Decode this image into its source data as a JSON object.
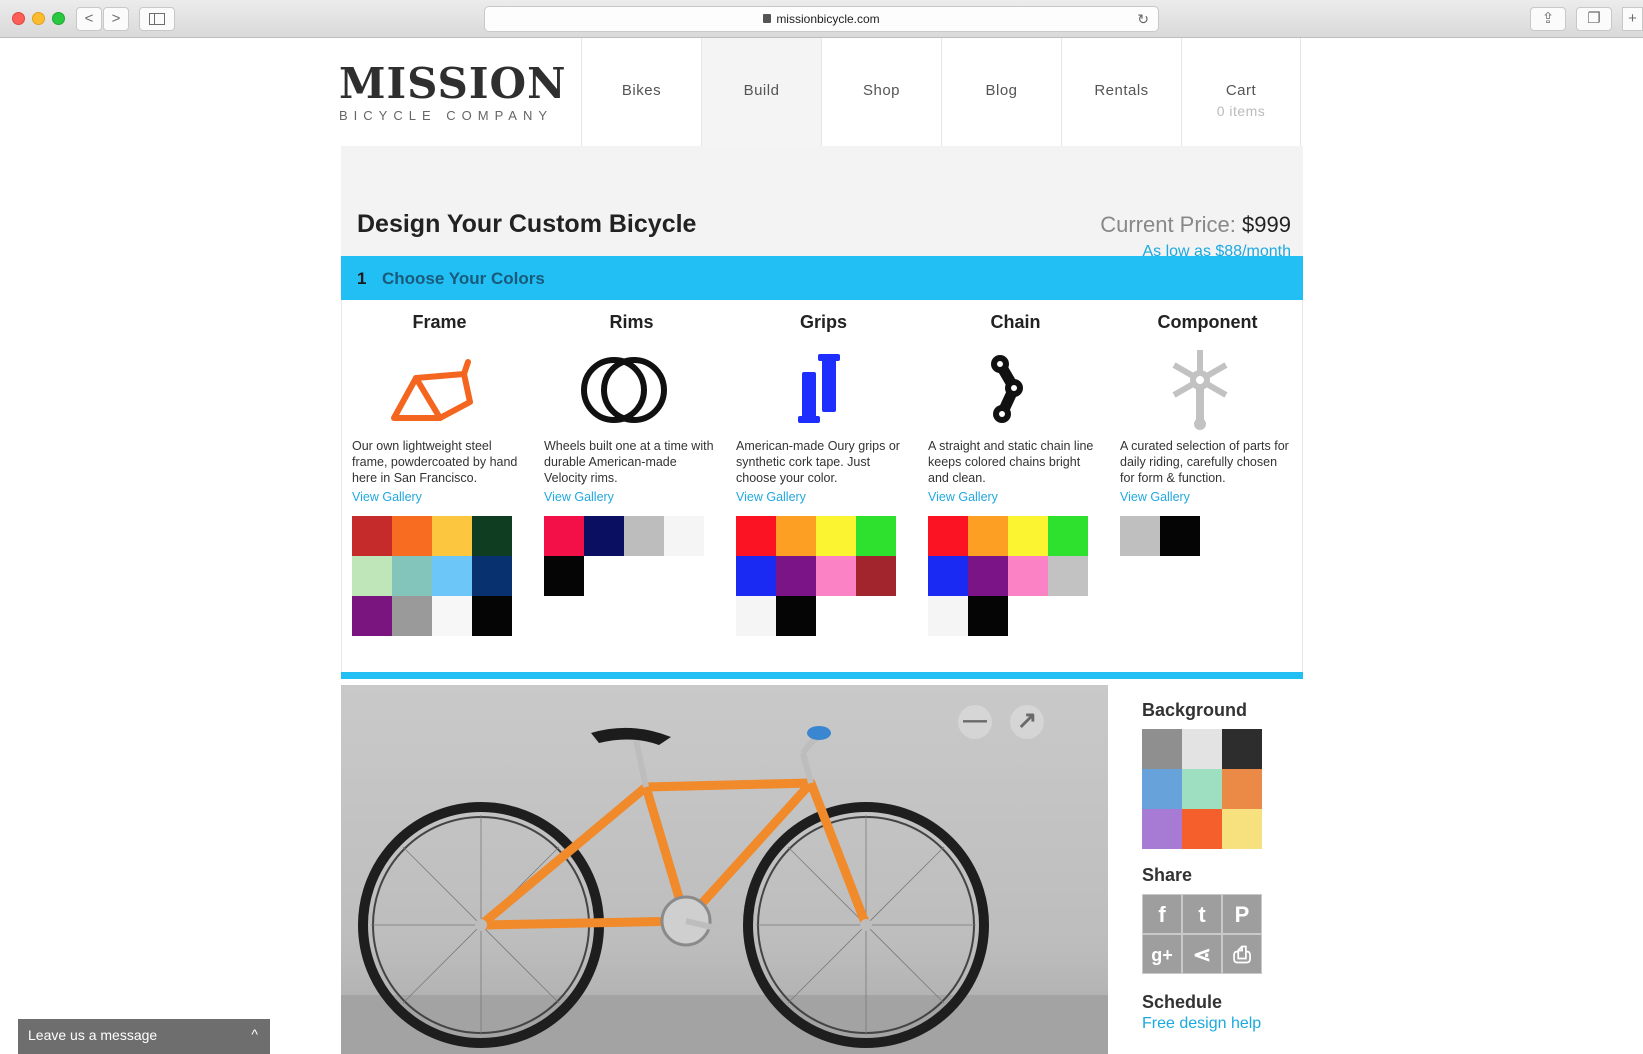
{
  "browser": {
    "url": "missionbicycle.com",
    "back_label": "<",
    "forward_label": ">",
    "reload_glyph": "↻",
    "share_glyph": "⇪",
    "tabs_glyph": "❐",
    "newtab_glyph": "+"
  },
  "logo": {
    "main": "MISSION",
    "sub": "BICYCLE COMPANY"
  },
  "nav": {
    "items": [
      "Bikes",
      "Build",
      "Shop",
      "Blog",
      "Rentals"
    ],
    "cart_label": "Cart",
    "cart_count": "0 items"
  },
  "header": {
    "title": "Design Your Custom Bicycle",
    "price_label": "Current Price:",
    "price_value": "$999",
    "monthly": "As low as $88/month"
  },
  "step": {
    "number": "1",
    "label": "Choose Your Colors"
  },
  "columns": [
    {
      "title": "Frame",
      "icon": "frame-icon",
      "icon_color": "#f4661f",
      "desc": "Our own lightweight steel frame, powdercoated by hand here in San Francisco.",
      "link": "View Gallery",
      "swatches": [
        "#c62b2b",
        "#f86c22",
        "#fcc73e",
        "#0f3d22",
        "#bfe6b8",
        "#83c4bb",
        "#6cc6f7",
        "#08316f",
        "#7a157f",
        "#9a9a9a",
        "#f7f7f7",
        "#050505"
      ]
    },
    {
      "title": "Rims",
      "icon": "rims-icon",
      "icon_color": "#111111",
      "desc": "Wheels built one at a time with durable American-made Velocity rims.",
      "link": "View Gallery",
      "swatches": [
        "#f31048",
        "#0b0f61",
        "#bdbdbd",
        "#f5f5f5",
        "#050505"
      ]
    },
    {
      "title": "Grips",
      "icon": "grips-icon",
      "icon_color": "#1e2eff",
      "desc": "American-made Oury grips or synthetic cork tape. Just choose your color.",
      "link": "View Gallery",
      "swatches": [
        "#fb1323",
        "#fc9f23",
        "#fbf431",
        "#2ee12e",
        "#1a2af2",
        "#7b1487",
        "#fb82c4",
        "#a2252e",
        "#f5f5f5",
        "#050505"
      ]
    },
    {
      "title": "Chain",
      "icon": "chain-icon",
      "icon_color": "#111111",
      "desc": "A straight and static chain line keeps colored chains bright and clean.",
      "link": "View Gallery",
      "swatches": [
        "#fb1323",
        "#fc9f23",
        "#fbf431",
        "#2ee12e",
        "#1a2af2",
        "#7b1487",
        "#fb82c4",
        "#c2c2c2",
        "#f5f5f5",
        "#050505"
      ]
    },
    {
      "title": "Component",
      "icon": "component-icon",
      "icon_color": "#c2c2c2",
      "desc": "A curated selection of parts for daily riding, carefully chosen for form & function.",
      "link": "View Gallery",
      "swatches": [
        "#bfbfbf",
        "#050505"
      ]
    }
  ],
  "preview": {
    "minimize_glyph": "—",
    "expand_glyph": "↗"
  },
  "sidebar": {
    "background_title": "Background",
    "background_swatches": [
      "#8f8f8f",
      "#e3e3e3",
      "#2d2d2d",
      "#67a3da",
      "#9fdfc1",
      "#eb8a47",
      "#a77ad3",
      "#f55f2c",
      "#f7e17e"
    ],
    "share_title": "Share",
    "share_icons": [
      {
        "name": "facebook-icon",
        "glyph": "f"
      },
      {
        "name": "twitter-icon",
        "glyph": "t"
      },
      {
        "name": "pinterest-icon",
        "glyph": "P"
      },
      {
        "name": "googleplus-icon",
        "glyph": "g+"
      },
      {
        "name": "share-icon",
        "glyph": "⋖"
      },
      {
        "name": "print-icon",
        "glyph": "⎙"
      }
    ],
    "schedule_title": "Schedule",
    "schedule_link": "Free design help"
  },
  "chat": {
    "label": "Leave us a message",
    "caret": "^"
  }
}
